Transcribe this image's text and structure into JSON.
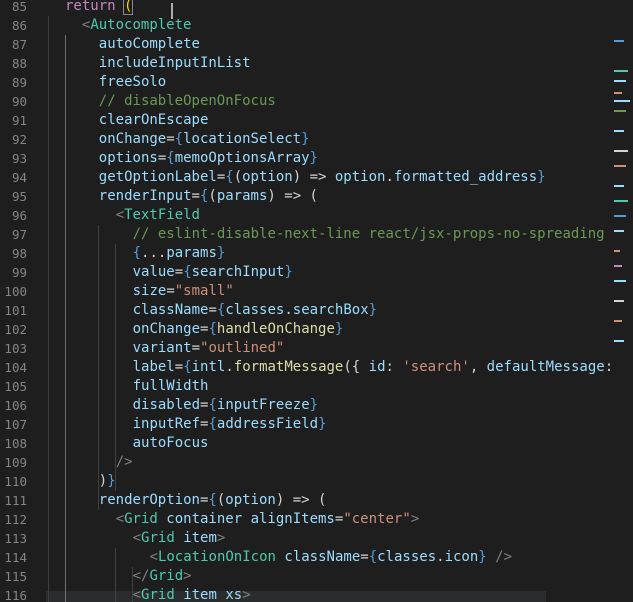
{
  "editor": {
    "lines": [
      {
        "n": "85",
        "tokens": [
          [
            "kw",
            "return"
          ],
          [
            "text",
            " "
          ],
          [
            "bracket-match",
            "("
          ]
        ]
      },
      {
        "n": "86",
        "tokens": [
          [
            "punct",
            "<"
          ],
          [
            "tag",
            "Autocomplete"
          ]
        ]
      },
      {
        "n": "87",
        "tokens": [
          [
            "attr",
            "autoComplete"
          ]
        ]
      },
      {
        "n": "88",
        "tokens": [
          [
            "attr",
            "includeInputInList"
          ]
        ]
      },
      {
        "n": "89",
        "tokens": [
          [
            "attr",
            "freeSolo"
          ]
        ]
      },
      {
        "n": "90",
        "tokens": [
          [
            "comment",
            "// disableOpenOnFocus"
          ]
        ]
      },
      {
        "n": "91",
        "tokens": [
          [
            "attr",
            "clearOnEscape"
          ]
        ]
      },
      {
        "n": "92",
        "tokens": [
          [
            "attr",
            "onChange"
          ],
          [
            "text",
            "="
          ],
          [
            "brace",
            "{"
          ],
          [
            "var",
            "locationSelect"
          ],
          [
            "brace",
            "}"
          ]
        ]
      },
      {
        "n": "93",
        "tokens": [
          [
            "attr",
            "options"
          ],
          [
            "text",
            "="
          ],
          [
            "brace",
            "{"
          ],
          [
            "var",
            "memoOptionsArray"
          ],
          [
            "brace",
            "}"
          ]
        ]
      },
      {
        "n": "94",
        "tokens": [
          [
            "attr",
            "getOptionLabel"
          ],
          [
            "text",
            "="
          ],
          [
            "brace",
            "{"
          ],
          [
            "paren",
            "("
          ],
          [
            "var",
            "option"
          ],
          [
            "paren",
            ")"
          ],
          [
            "text",
            " => "
          ],
          [
            "var",
            "option"
          ],
          [
            "text",
            "."
          ],
          [
            "var",
            "formatted_address"
          ],
          [
            "brace",
            "}"
          ]
        ]
      },
      {
        "n": "95",
        "tokens": [
          [
            "attr",
            "renderInput"
          ],
          [
            "text",
            "="
          ],
          [
            "brace",
            "{"
          ],
          [
            "paren",
            "("
          ],
          [
            "var",
            "params"
          ],
          [
            "paren",
            ")"
          ],
          [
            "text",
            " => ("
          ]
        ]
      },
      {
        "n": "96",
        "tokens": [
          [
            "punct",
            "<"
          ],
          [
            "tag",
            "TextField"
          ]
        ]
      },
      {
        "n": "97",
        "tokens": [
          [
            "comment",
            "// eslint-disable-next-line react/jsx-props-no-spreading"
          ]
        ]
      },
      {
        "n": "98",
        "tokens": [
          [
            "brace",
            "{"
          ],
          [
            "text",
            "..."
          ],
          [
            "var",
            "params"
          ],
          [
            "brace",
            "}"
          ]
        ]
      },
      {
        "n": "99",
        "tokens": [
          [
            "attr",
            "value"
          ],
          [
            "text",
            "="
          ],
          [
            "brace",
            "{"
          ],
          [
            "var",
            "searchInput"
          ],
          [
            "brace",
            "}"
          ]
        ]
      },
      {
        "n": "100",
        "tokens": [
          [
            "attr",
            "size"
          ],
          [
            "text",
            "="
          ],
          [
            "str",
            "\"small\""
          ]
        ]
      },
      {
        "n": "101",
        "tokens": [
          [
            "attr",
            "className"
          ],
          [
            "text",
            "="
          ],
          [
            "brace",
            "{"
          ],
          [
            "var",
            "classes"
          ],
          [
            "text",
            "."
          ],
          [
            "var",
            "searchBox"
          ],
          [
            "brace",
            "}"
          ]
        ]
      },
      {
        "n": "102",
        "tokens": [
          [
            "attr",
            "onChange"
          ],
          [
            "text",
            "="
          ],
          [
            "brace",
            "{"
          ],
          [
            "fn",
            "handleOnChange"
          ],
          [
            "brace",
            "}"
          ]
        ]
      },
      {
        "n": "103",
        "tokens": [
          [
            "attr",
            "variant"
          ],
          [
            "text",
            "="
          ],
          [
            "str",
            "\"outlined\""
          ]
        ]
      },
      {
        "n": "104",
        "tokens": [
          [
            "attr",
            "label"
          ],
          [
            "text",
            "="
          ],
          [
            "brace",
            "{"
          ],
          [
            "var",
            "intl"
          ],
          [
            "text",
            "."
          ],
          [
            "fn",
            "formatMessage"
          ],
          [
            "text",
            "({ "
          ],
          [
            "var",
            "id"
          ],
          [
            "text",
            ": "
          ],
          [
            "str",
            "'search'"
          ],
          [
            "text",
            ", "
          ],
          [
            "var",
            "defaultMessage"
          ],
          [
            "text",
            ":"
          ]
        ]
      },
      {
        "n": "105",
        "tokens": [
          [
            "attr",
            "fullWidth"
          ]
        ]
      },
      {
        "n": "106",
        "tokens": [
          [
            "attr",
            "disabled"
          ],
          [
            "text",
            "="
          ],
          [
            "brace",
            "{"
          ],
          [
            "var",
            "inputFreeze"
          ],
          [
            "brace",
            "}"
          ]
        ]
      },
      {
        "n": "107",
        "tokens": [
          [
            "attr",
            "inputRef"
          ],
          [
            "text",
            "="
          ],
          [
            "brace",
            "{"
          ],
          [
            "var",
            "addressField"
          ],
          [
            "brace",
            "}"
          ]
        ]
      },
      {
        "n": "108",
        "tokens": [
          [
            "attr",
            "autoFocus"
          ]
        ]
      },
      {
        "n": "109",
        "tokens": [
          [
            "punct",
            "/>"
          ]
        ]
      },
      {
        "n": "110",
        "tokens": [
          [
            "text",
            ")"
          ],
          [
            "brace",
            "}"
          ]
        ]
      },
      {
        "n": "111",
        "tokens": [
          [
            "attr",
            "renderOption"
          ],
          [
            "text",
            "="
          ],
          [
            "brace",
            "{"
          ],
          [
            "paren",
            "("
          ],
          [
            "var",
            "option"
          ],
          [
            "paren",
            ")"
          ],
          [
            "text",
            " => ("
          ]
        ]
      },
      {
        "n": "112",
        "tokens": [
          [
            "punct",
            "<"
          ],
          [
            "tag",
            "Grid"
          ],
          [
            "text",
            " "
          ],
          [
            "attr",
            "container"
          ],
          [
            "text",
            " "
          ],
          [
            "attr",
            "alignItems"
          ],
          [
            "text",
            "="
          ],
          [
            "str",
            "\"center\""
          ],
          [
            "punct",
            ">"
          ]
        ]
      },
      {
        "n": "113",
        "tokens": [
          [
            "punct",
            "<"
          ],
          [
            "tag",
            "Grid"
          ],
          [
            "text",
            " "
          ],
          [
            "attr",
            "item"
          ],
          [
            "punct",
            ">"
          ]
        ]
      },
      {
        "n": "114",
        "tokens": [
          [
            "punct",
            "<"
          ],
          [
            "tag",
            "LocationOnIcon"
          ],
          [
            "text",
            " "
          ],
          [
            "attr",
            "className"
          ],
          [
            "text",
            "="
          ],
          [
            "brace",
            "{"
          ],
          [
            "var",
            "classes"
          ],
          [
            "text",
            "."
          ],
          [
            "var",
            "icon"
          ],
          [
            "brace",
            "}"
          ],
          [
            "text",
            " "
          ],
          [
            "punct",
            "/>"
          ]
        ]
      },
      {
        "n": "115",
        "tokens": [
          [
            "punct",
            "</"
          ],
          [
            "tag",
            "Grid"
          ],
          [
            "punct",
            ">"
          ]
        ]
      },
      {
        "n": "116",
        "tokens": [
          [
            "punct",
            "<"
          ],
          [
            "tag",
            "Grid"
          ],
          [
            "text",
            " "
          ],
          [
            "attr",
            "item"
          ],
          [
            "text",
            " "
          ],
          [
            "attr",
            "xs"
          ],
          [
            "punct",
            ">"
          ]
        ]
      }
    ]
  }
}
